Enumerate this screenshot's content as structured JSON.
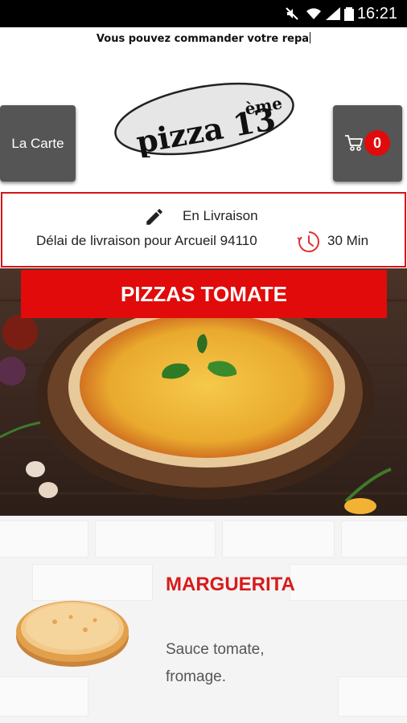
{
  "status_bar": {
    "time": "16:21"
  },
  "marquee": {
    "text": "Vous pouvez commander votre repa"
  },
  "header": {
    "menu_button_label": "La Carte",
    "logo_text": "pizza 13ème",
    "cart_count": "0"
  },
  "delivery": {
    "mode": "En Livraison",
    "info": "Délai de livraison pour Arcueil 94110",
    "time": "30 Min"
  },
  "category": {
    "title": "PIZZAS TOMATE"
  },
  "products": [
    {
      "name": "MARGUERITA",
      "description": "Sauce tomate, fromage."
    }
  ],
  "colors": {
    "accent": "#e10b0b",
    "button_bg": "#555555",
    "product_name": "#d81b1b"
  }
}
